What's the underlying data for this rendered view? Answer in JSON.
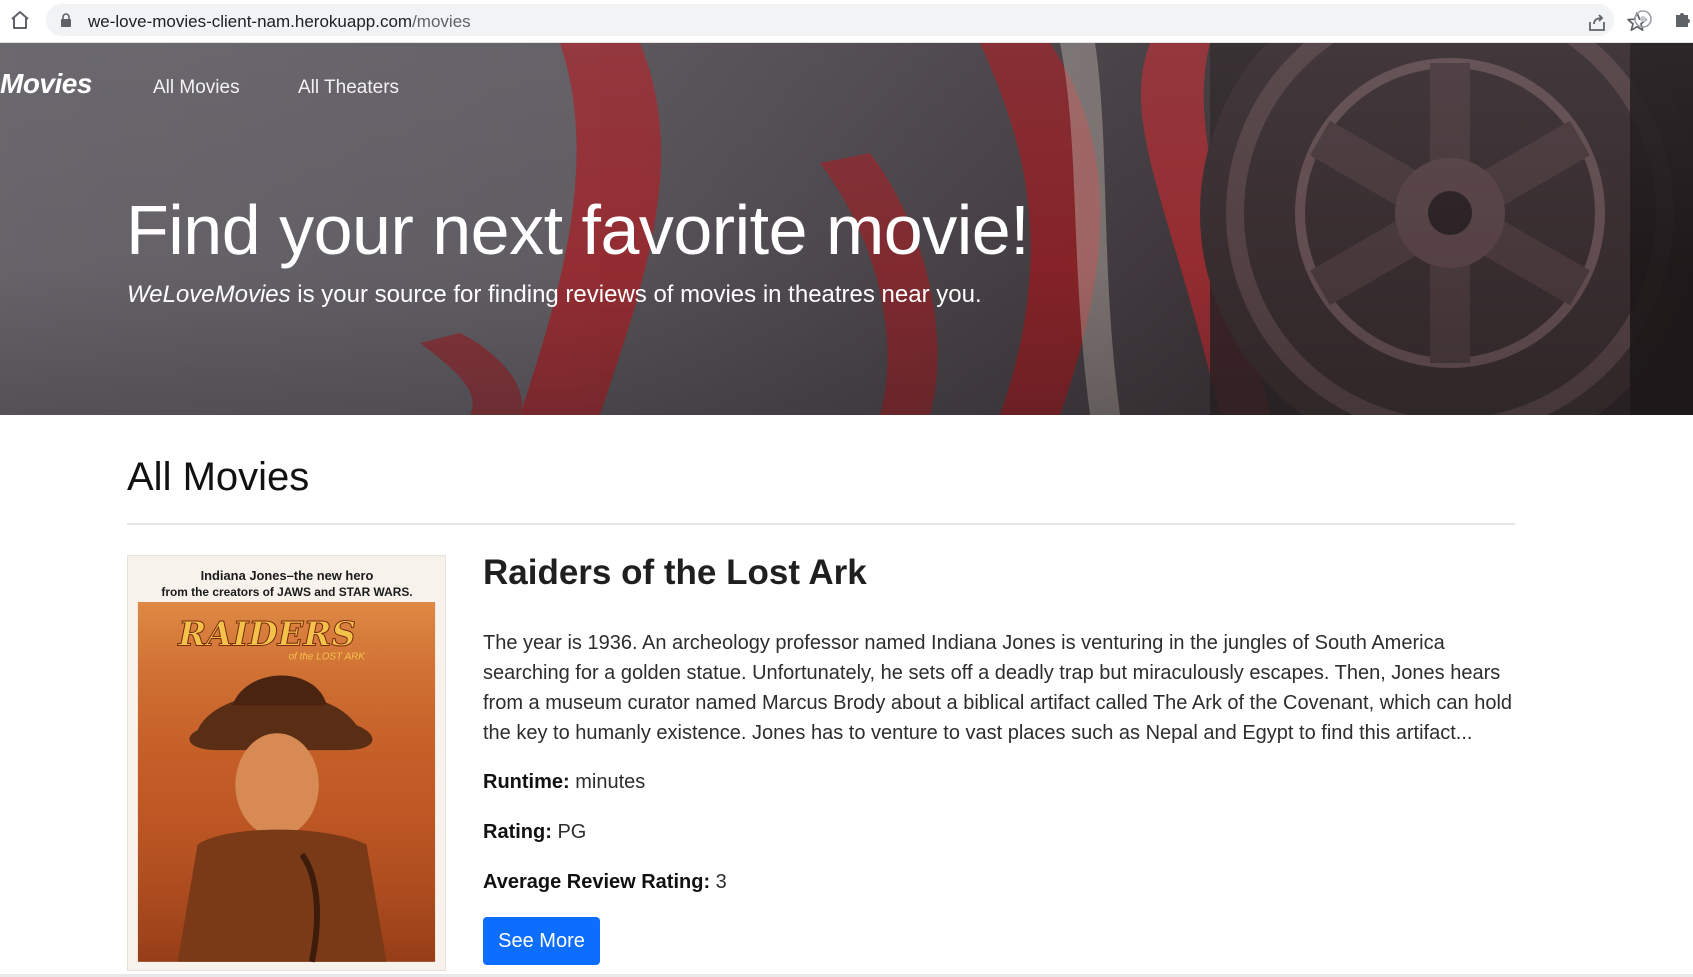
{
  "browser": {
    "url_host": "we-love-movies-client-nam.herokuapp.com",
    "url_path": "/movies"
  },
  "navbar": {
    "brand": "Movies",
    "links": [
      {
        "label": "All Movies"
      },
      {
        "label": "All Theaters"
      }
    ]
  },
  "hero": {
    "title": "Find your next favorite movie!",
    "subtitle_brand": "WeLoveMovies",
    "subtitle_rest": " is your source for finding reviews of movies in theatres near you."
  },
  "main": {
    "section_title": "All Movies",
    "movies": [
      {
        "title": "Raiders of the Lost Ark",
        "poster": {
          "tagline_1": "Indiana Jones–the new hero",
          "tagline_2": "from the creators of JAWS and STAR WARS.",
          "logo_text": "RAIDERS",
          "logo_sub": "of the LOST ARK"
        },
        "description": "The year is 1936. An archeology professor named Indiana Jones is venturing in the jungles of South America searching for a golden statue. Unfortunately, he sets off a deadly trap but miraculously escapes. Then, Jones hears from a museum curator named Marcus Brody about a biblical artifact called The Ark of the Covenant, which can hold the key to humanly existence. Jones has to venture to vast places such as Nepal and Egypt to find this artifact...",
        "runtime_label": "Runtime:",
        "runtime_value": " minutes",
        "rating_label": "Rating:",
        "rating_value": " PG",
        "avg_label": "Average Review Rating:",
        "avg_value": " 3",
        "button_label": "See More"
      }
    ]
  },
  "colors": {
    "primary_button": "#0d6efd",
    "hero_film_red": "#b3262b"
  }
}
